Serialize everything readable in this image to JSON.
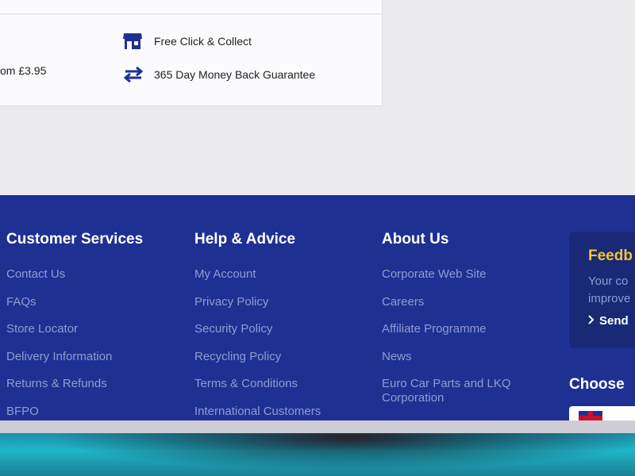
{
  "delivery_card": {
    "left_text": "om £3.95",
    "collect_label": "Free Click & Collect",
    "guarantee_label": "365 Day Money Back Guarantee",
    "collect_icon": "store-icon",
    "guarantee_icon": "exchange-arrows-icon"
  },
  "footer": {
    "customer_services": {
      "heading": "Customer Services",
      "links": [
        "Contact Us",
        "FAQs",
        "Store Locator",
        "Delivery Information",
        "Returns & Refunds",
        "BFPO"
      ]
    },
    "help_advice": {
      "heading": "Help & Advice",
      "links": [
        "My Account",
        "Privacy Policy",
        "Security Policy",
        "Recycling Policy",
        "Terms & Conditions",
        "International Customers"
      ]
    },
    "about_us": {
      "heading": "About Us",
      "links": [
        "Corporate Web Site",
        "Careers",
        "Affiliate Programme",
        "News",
        "Euro Car Parts and LKQ Corporation"
      ]
    },
    "feedback": {
      "title": "Feedb",
      "text_line1": "Your co",
      "text_line2": "improve",
      "link": "Send"
    },
    "choose": "Choose"
  },
  "colors": {
    "footer_bg": "#1e3192",
    "link": "#8f9bd2",
    "accent": "#f4c533"
  }
}
